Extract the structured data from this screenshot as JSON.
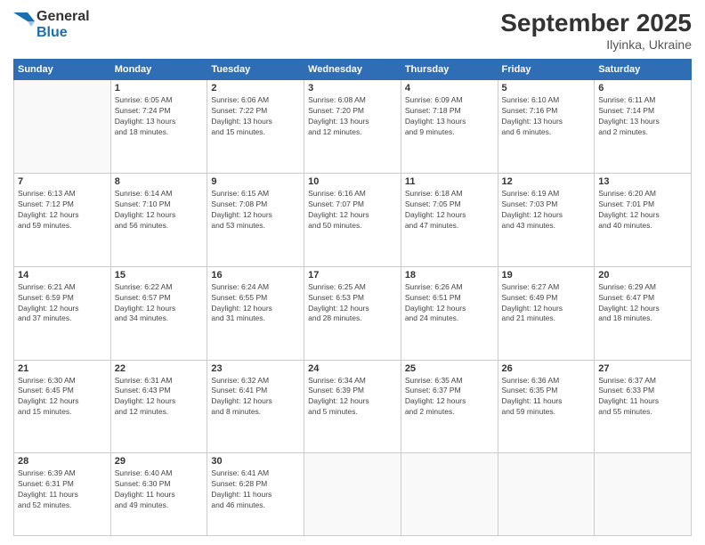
{
  "header": {
    "logo_general": "General",
    "logo_blue": "Blue",
    "month_title": "September 2025",
    "location": "Ilyinka, Ukraine"
  },
  "days_of_week": [
    "Sunday",
    "Monday",
    "Tuesday",
    "Wednesday",
    "Thursday",
    "Friday",
    "Saturday"
  ],
  "weeks": [
    [
      {
        "day": "",
        "info": ""
      },
      {
        "day": "1",
        "info": "Sunrise: 6:05 AM\nSunset: 7:24 PM\nDaylight: 13 hours\nand 18 minutes."
      },
      {
        "day": "2",
        "info": "Sunrise: 6:06 AM\nSunset: 7:22 PM\nDaylight: 13 hours\nand 15 minutes."
      },
      {
        "day": "3",
        "info": "Sunrise: 6:08 AM\nSunset: 7:20 PM\nDaylight: 13 hours\nand 12 minutes."
      },
      {
        "day": "4",
        "info": "Sunrise: 6:09 AM\nSunset: 7:18 PM\nDaylight: 13 hours\nand 9 minutes."
      },
      {
        "day": "5",
        "info": "Sunrise: 6:10 AM\nSunset: 7:16 PM\nDaylight: 13 hours\nand 6 minutes."
      },
      {
        "day": "6",
        "info": "Sunrise: 6:11 AM\nSunset: 7:14 PM\nDaylight: 13 hours\nand 2 minutes."
      }
    ],
    [
      {
        "day": "7",
        "info": "Sunrise: 6:13 AM\nSunset: 7:12 PM\nDaylight: 12 hours\nand 59 minutes."
      },
      {
        "day": "8",
        "info": "Sunrise: 6:14 AM\nSunset: 7:10 PM\nDaylight: 12 hours\nand 56 minutes."
      },
      {
        "day": "9",
        "info": "Sunrise: 6:15 AM\nSunset: 7:08 PM\nDaylight: 12 hours\nand 53 minutes."
      },
      {
        "day": "10",
        "info": "Sunrise: 6:16 AM\nSunset: 7:07 PM\nDaylight: 12 hours\nand 50 minutes."
      },
      {
        "day": "11",
        "info": "Sunrise: 6:18 AM\nSunset: 7:05 PM\nDaylight: 12 hours\nand 47 minutes."
      },
      {
        "day": "12",
        "info": "Sunrise: 6:19 AM\nSunset: 7:03 PM\nDaylight: 12 hours\nand 43 minutes."
      },
      {
        "day": "13",
        "info": "Sunrise: 6:20 AM\nSunset: 7:01 PM\nDaylight: 12 hours\nand 40 minutes."
      }
    ],
    [
      {
        "day": "14",
        "info": "Sunrise: 6:21 AM\nSunset: 6:59 PM\nDaylight: 12 hours\nand 37 minutes."
      },
      {
        "day": "15",
        "info": "Sunrise: 6:22 AM\nSunset: 6:57 PM\nDaylight: 12 hours\nand 34 minutes."
      },
      {
        "day": "16",
        "info": "Sunrise: 6:24 AM\nSunset: 6:55 PM\nDaylight: 12 hours\nand 31 minutes."
      },
      {
        "day": "17",
        "info": "Sunrise: 6:25 AM\nSunset: 6:53 PM\nDaylight: 12 hours\nand 28 minutes."
      },
      {
        "day": "18",
        "info": "Sunrise: 6:26 AM\nSunset: 6:51 PM\nDaylight: 12 hours\nand 24 minutes."
      },
      {
        "day": "19",
        "info": "Sunrise: 6:27 AM\nSunset: 6:49 PM\nDaylight: 12 hours\nand 21 minutes."
      },
      {
        "day": "20",
        "info": "Sunrise: 6:29 AM\nSunset: 6:47 PM\nDaylight: 12 hours\nand 18 minutes."
      }
    ],
    [
      {
        "day": "21",
        "info": "Sunrise: 6:30 AM\nSunset: 6:45 PM\nDaylight: 12 hours\nand 15 minutes."
      },
      {
        "day": "22",
        "info": "Sunrise: 6:31 AM\nSunset: 6:43 PM\nDaylight: 12 hours\nand 12 minutes."
      },
      {
        "day": "23",
        "info": "Sunrise: 6:32 AM\nSunset: 6:41 PM\nDaylight: 12 hours\nand 8 minutes."
      },
      {
        "day": "24",
        "info": "Sunrise: 6:34 AM\nSunset: 6:39 PM\nDaylight: 12 hours\nand 5 minutes."
      },
      {
        "day": "25",
        "info": "Sunrise: 6:35 AM\nSunset: 6:37 PM\nDaylight: 12 hours\nand 2 minutes."
      },
      {
        "day": "26",
        "info": "Sunrise: 6:36 AM\nSunset: 6:35 PM\nDaylight: 11 hours\nand 59 minutes."
      },
      {
        "day": "27",
        "info": "Sunrise: 6:37 AM\nSunset: 6:33 PM\nDaylight: 11 hours\nand 55 minutes."
      }
    ],
    [
      {
        "day": "28",
        "info": "Sunrise: 6:39 AM\nSunset: 6:31 PM\nDaylight: 11 hours\nand 52 minutes."
      },
      {
        "day": "29",
        "info": "Sunrise: 6:40 AM\nSunset: 6:30 PM\nDaylight: 11 hours\nand 49 minutes."
      },
      {
        "day": "30",
        "info": "Sunrise: 6:41 AM\nSunset: 6:28 PM\nDaylight: 11 hours\nand 46 minutes."
      },
      {
        "day": "",
        "info": ""
      },
      {
        "day": "",
        "info": ""
      },
      {
        "day": "",
        "info": ""
      },
      {
        "day": "",
        "info": ""
      }
    ]
  ]
}
